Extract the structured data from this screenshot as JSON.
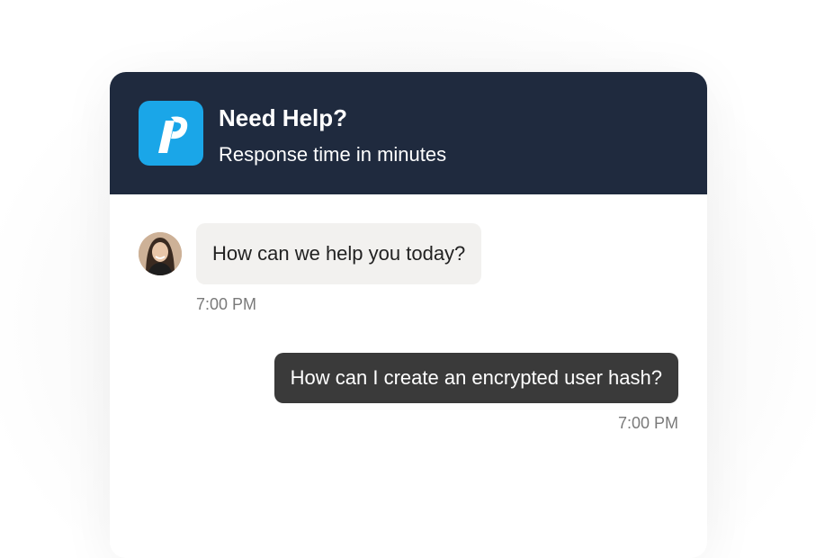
{
  "header": {
    "title": "Need Help?",
    "subtitle": "Response time in minutes",
    "logo_icon": "brand-logo-icon"
  },
  "messages": [
    {
      "sender": "agent",
      "avatar_icon": "agent-avatar",
      "text": "How can we help you today?",
      "time": "7:00 PM"
    },
    {
      "sender": "user",
      "text": "How can I create an encrypted user hash?",
      "time": "7:00 PM"
    }
  ],
  "colors": {
    "header_bg": "#1f2a3e",
    "logo_bg": "#1aa6e8",
    "incoming_bubble": "#f2f1ef",
    "outgoing_bubble": "#3a3a3a",
    "timestamp": "#7a7a7a"
  }
}
